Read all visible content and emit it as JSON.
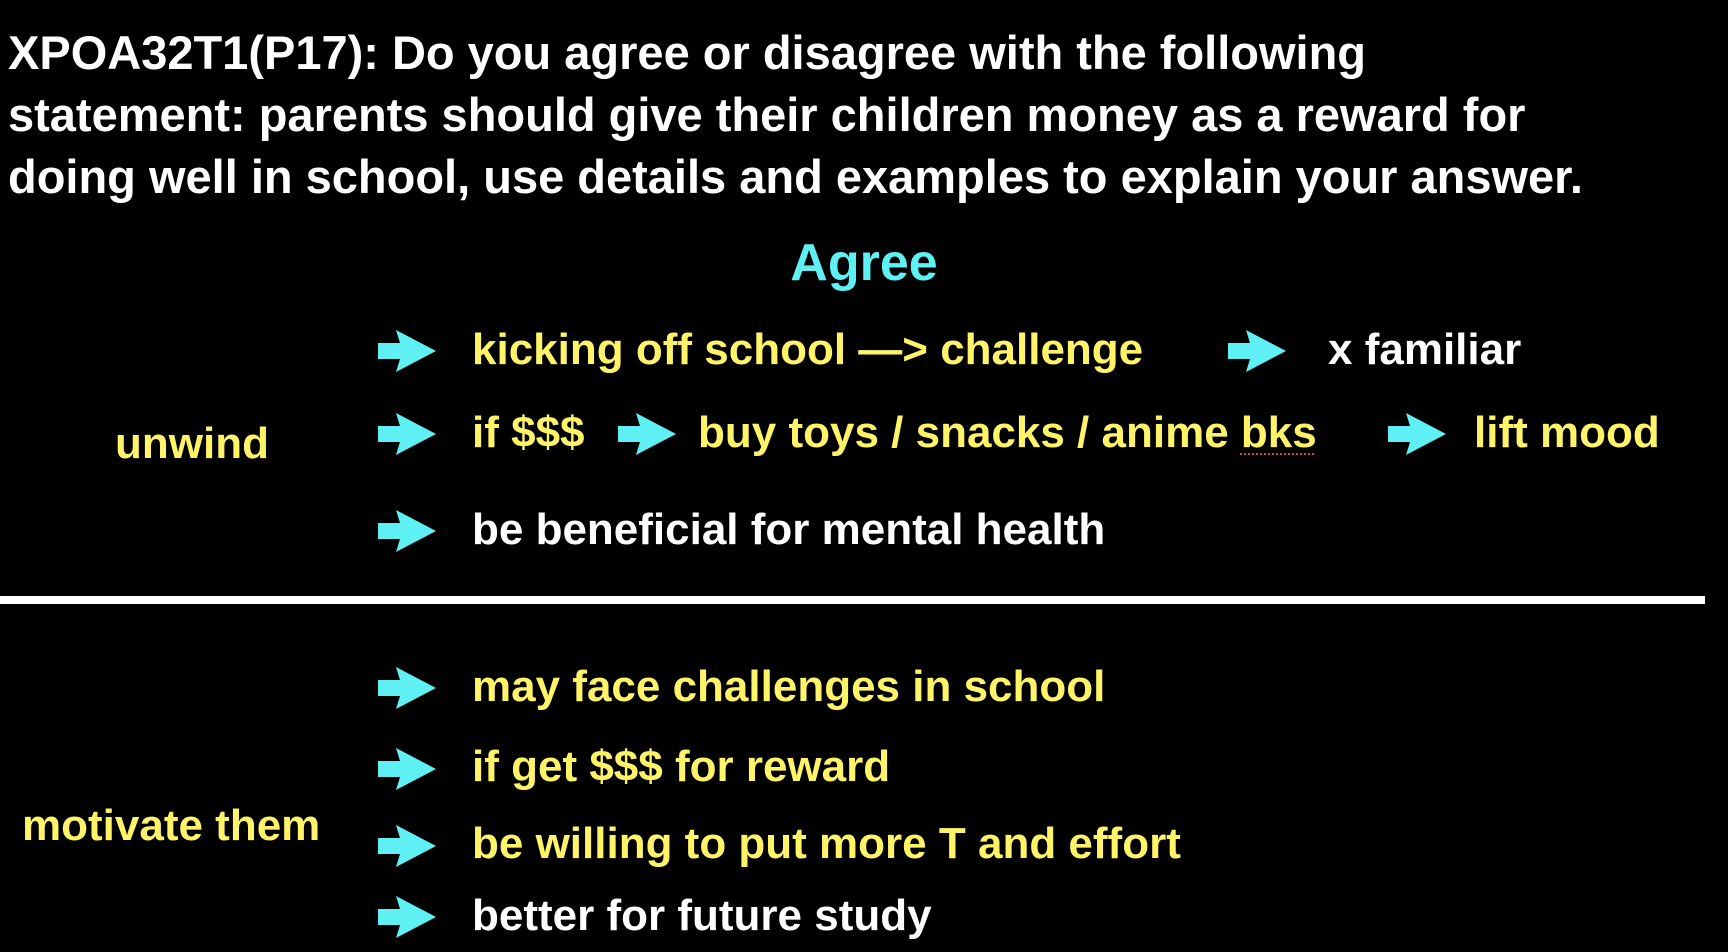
{
  "prompt": {
    "line1": "XPOA32T1(P17): Do you agree or disagree with the following",
    "line2": "statement: parents should give their children money as a reward for",
    "line3": "doing well in school, use details and examples to explain your answer."
  },
  "stance": "Agree",
  "colors": {
    "background": "#000000",
    "heading": "#ffffff",
    "stance": "#5ff0f4",
    "arrow": "#5ff0f4",
    "highlight": "#fff467",
    "plain": "#ffffff"
  },
  "section1": {
    "label": "unwind",
    "row1": {
      "part1": "kicking off school —> challenge",
      "part2": "x familiar"
    },
    "row2": {
      "part1": "if $$$",
      "part2_a": "buy toys / snacks / anime ",
      "part2_b": "bks",
      "part3": "lift mood"
    },
    "row3": {
      "part1": "be beneficial for mental health"
    }
  },
  "section2": {
    "label": "motivate them",
    "row1": "may face challenges in school",
    "row2": "if get $$$ for reward",
    "row3": "be willing to put more T and effort",
    "row4": "better for future study"
  }
}
